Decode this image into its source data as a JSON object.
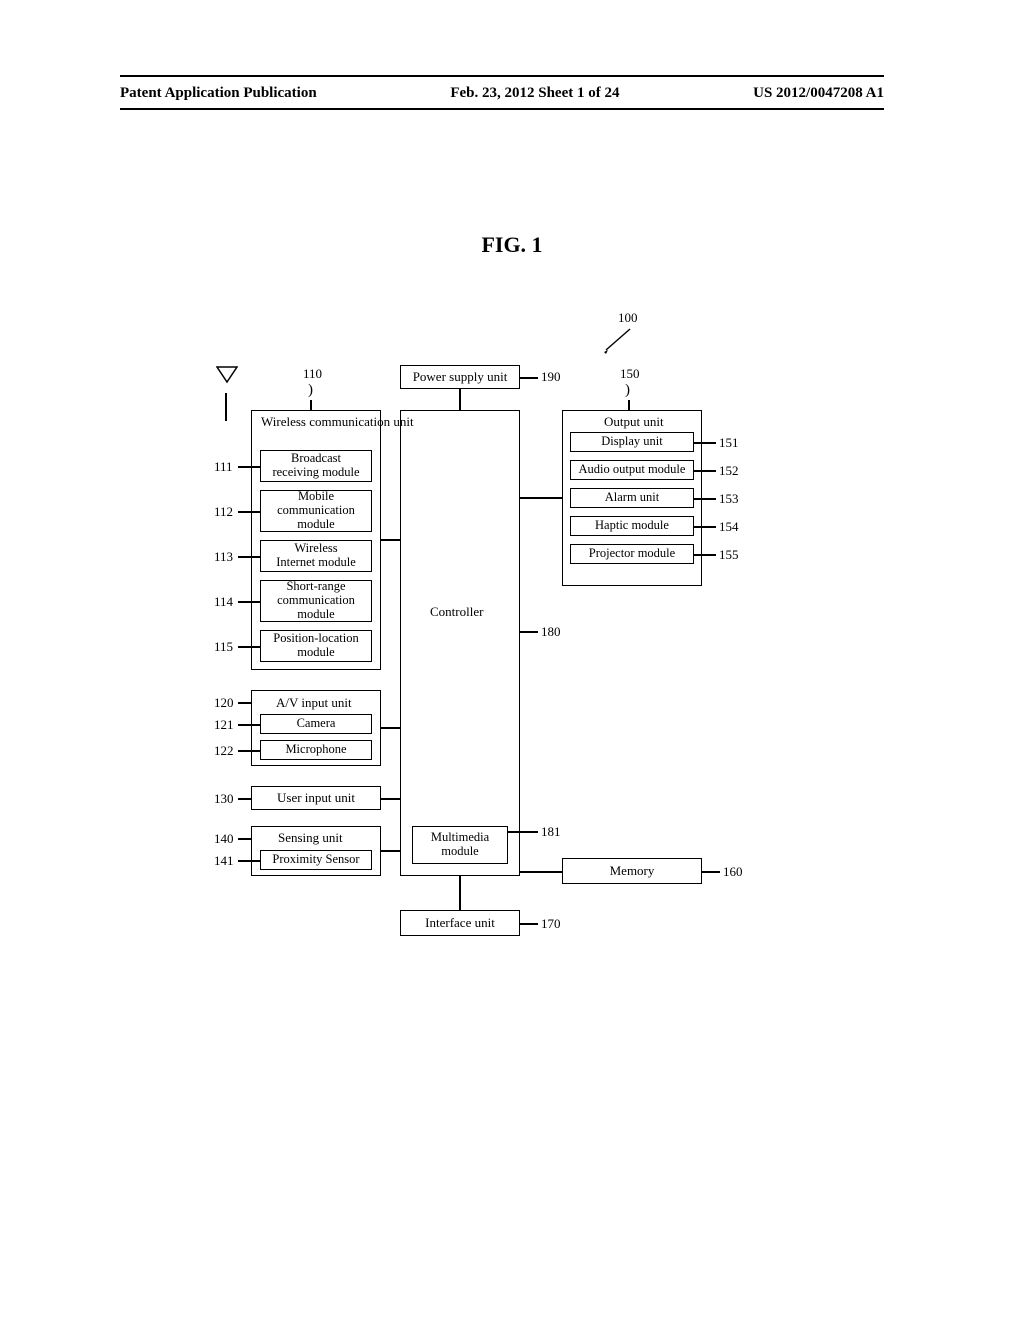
{
  "header": {
    "left": "Patent Application Publication",
    "center": "Feb. 23, 2012  Sheet 1 of 24",
    "right": "US 2012/0047208 A1"
  },
  "figure_label": "FIG.  1",
  "refs": {
    "r100": "100",
    "r110": "110",
    "r111": "111",
    "r112": "112",
    "r113": "113",
    "r114": "114",
    "r115": "115",
    "r120": "120",
    "r121": "121",
    "r122": "122",
    "r130": "130",
    "r140": "140",
    "r141": "141",
    "r150": "150",
    "r151": "151",
    "r152": "152",
    "r153": "153",
    "r154": "154",
    "r155": "155",
    "r160": "160",
    "r170": "170",
    "r180": "180",
    "r181": "181",
    "r190": "190"
  },
  "blocks": {
    "power": "Power supply unit",
    "wcu": "Wireless\ncommunication unit",
    "broadcast": "Broadcast\nreceiving module",
    "mobile": "Mobile\ncommunication\nmodule",
    "winternet": "Wireless\nInternet module",
    "short": "Short-range\ncommunication\nmodule",
    "poslocation": "Position-location\nmodule",
    "av": "A/V input unit",
    "camera": "Camera",
    "mic": "Microphone",
    "userinput": "User input unit",
    "sensing": "Sensing unit",
    "proximity": "Proximity Sensor",
    "controller": "Controller",
    "multimedia": "Multimedia\nmodule",
    "output": "Output unit",
    "display": "Display unit",
    "audio": "Audio output module",
    "alarm": "Alarm unit",
    "haptic": "Haptic module",
    "projector": "Projector module",
    "memory": "Memory",
    "interface": "Interface unit"
  }
}
